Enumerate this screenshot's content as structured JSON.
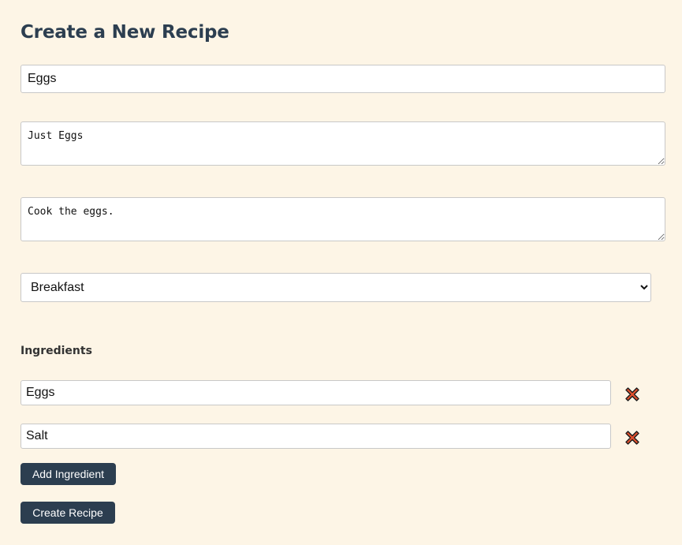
{
  "form": {
    "heading": "Create a New Recipe",
    "title_value": "Eggs",
    "description_value": "Just Eggs",
    "instructions_value": "Cook the eggs.",
    "category": {
      "selected": "Breakfast",
      "options": [
        "Breakfast"
      ]
    },
    "ingredients_heading": "Ingredients",
    "ingredients": [
      {
        "value": "Eggs",
        "remove_icon": "close-x-icon"
      },
      {
        "value": "Salt",
        "remove_icon": "close-x-icon"
      }
    ],
    "add_ingredient_label": "Add Ingredient",
    "create_recipe_label": "Create Recipe"
  },
  "colors": {
    "background": "#fdf5e6",
    "heading": "#2c3e50",
    "button_bg": "#2c3e50",
    "remove_icon_fill": "#e0502d"
  }
}
